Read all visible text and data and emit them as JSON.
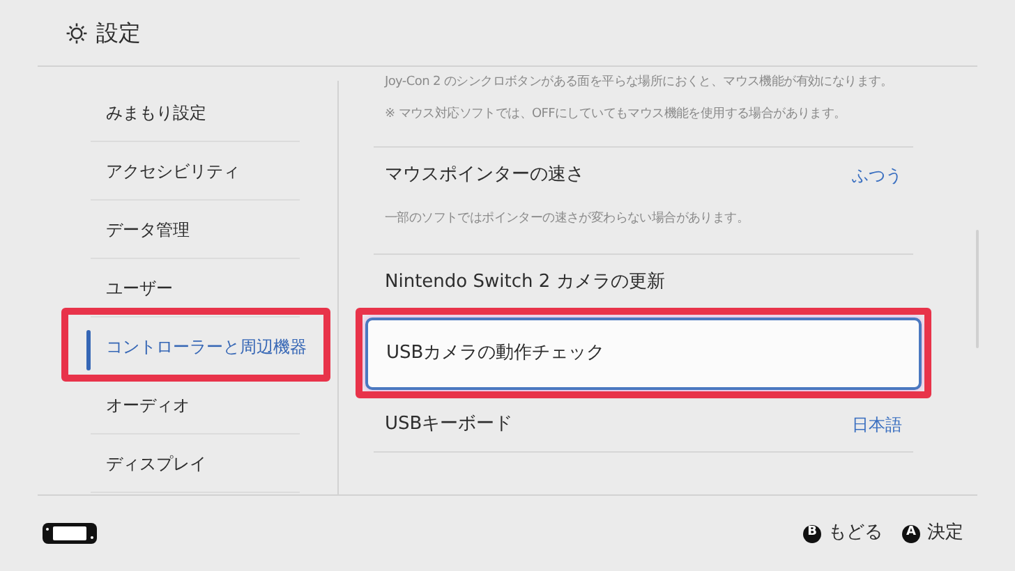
{
  "header": {
    "title": "設定"
  },
  "sidebar": {
    "items": [
      {
        "label": "みまもり設定",
        "selected": false,
        "highlighted": false
      },
      {
        "label": "アクセシビリティ",
        "selected": false,
        "highlighted": false
      },
      {
        "label": "データ管理",
        "selected": false,
        "highlighted": false
      },
      {
        "label": "ユーザー",
        "selected": false,
        "highlighted": false
      },
      {
        "label": "コントローラーと周辺機器",
        "selected": true,
        "highlighted": true
      },
      {
        "label": "オーディオ",
        "selected": false,
        "highlighted": false
      },
      {
        "label": "ディスプレイ",
        "selected": false,
        "highlighted": false
      }
    ]
  },
  "content": {
    "items": [
      {
        "kind": "note",
        "text": "Joy-Con 2 のシンクロボタンがある面を平らな場所におくと、マウス機能が有効になります。"
      },
      {
        "kind": "note",
        "text": "※ マウス対応ソフトでは、OFFにしていてもマウス機能を使用する場合があります。"
      },
      {
        "kind": "setting",
        "label": "マウスポインターの速さ",
        "value": "ふつう",
        "selected": false,
        "highlighted": false
      },
      {
        "kind": "note",
        "text": "一部のソフトではポインターの速さが変わらない場合があります。"
      },
      {
        "kind": "setting",
        "label": "Nintendo Switch 2 カメラの更新",
        "selected": false,
        "highlighted": false
      },
      {
        "kind": "setting",
        "label": "USBカメラの動作チェック",
        "selected": true,
        "highlighted": true
      },
      {
        "kind": "setting",
        "label": "USBキーボード",
        "value": "日本語",
        "selected": false,
        "highlighted": false
      },
      {
        "kind": "blank"
      }
    ]
  },
  "footer": {
    "hints": [
      {
        "button": "B",
        "label": "もどる"
      },
      {
        "button": "A",
        "label": "決定"
      }
    ]
  }
}
